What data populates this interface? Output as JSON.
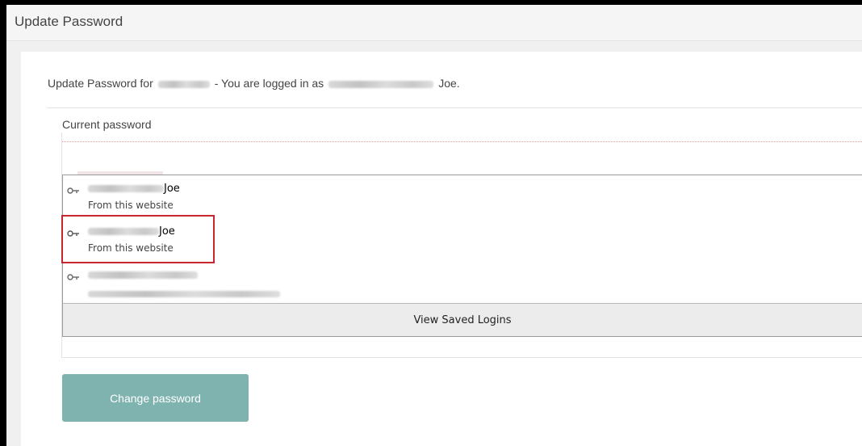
{
  "panel": {
    "title": "Update Password"
  },
  "intro": {
    "prefix": "Update Password for",
    "separator": "-  You are logged in as",
    "user_suffix": "Joe",
    "end": "."
  },
  "form": {
    "current_password_label": "Current password",
    "current_password_value": "",
    "change_button_label": "Change password"
  },
  "autofill": {
    "items": [
      {
        "user_suffix": "Joe",
        "source": "From this website"
      },
      {
        "user_suffix": "Joe",
        "source": "From this website"
      },
      {
        "user_suffix": "",
        "source": ""
      }
    ],
    "view_saved_label": "View Saved Logins"
  },
  "colors": {
    "highlight": "#c8262b",
    "button": "#7fb3b0"
  }
}
